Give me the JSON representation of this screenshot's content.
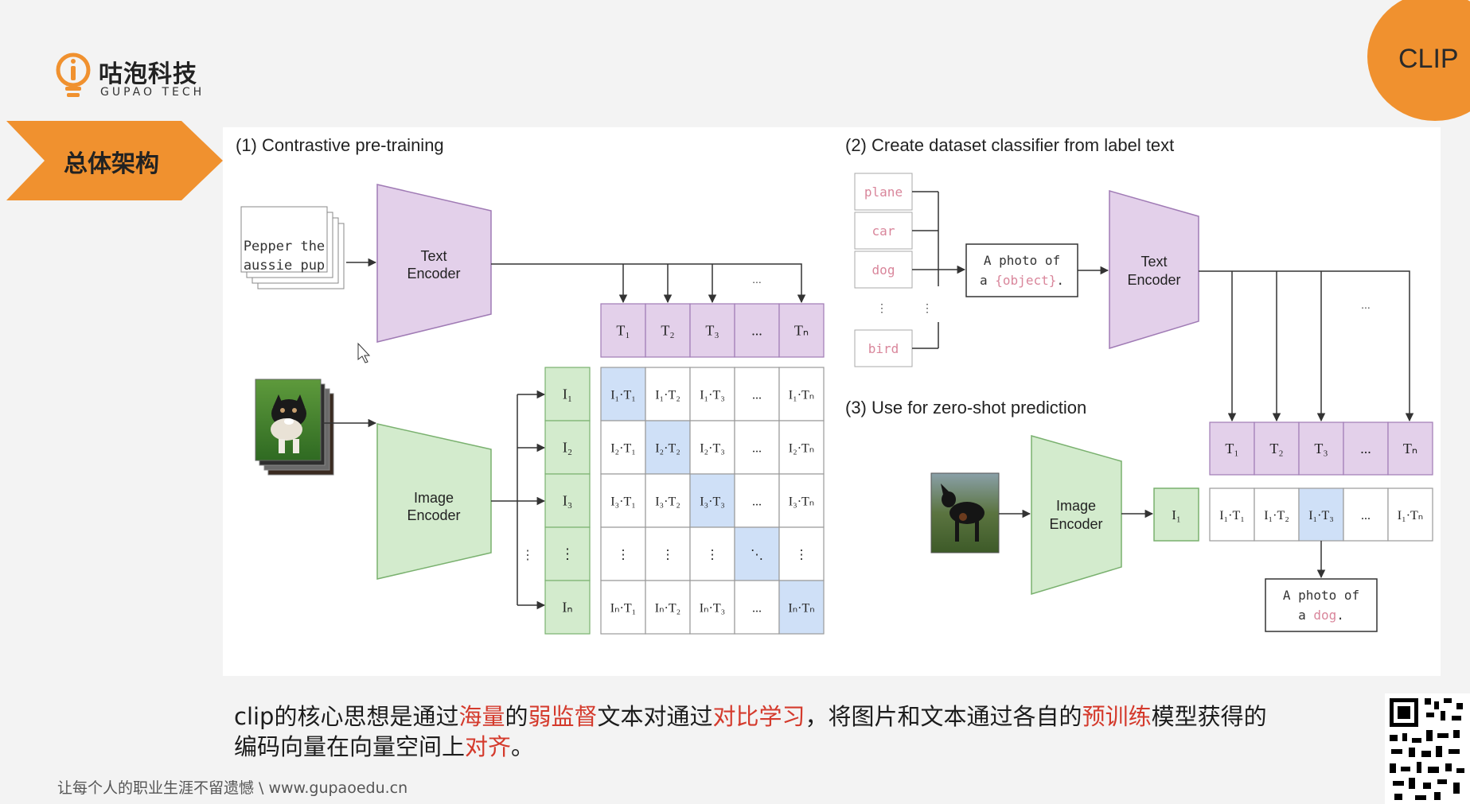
{
  "logo": {
    "cn": "咕泡科技",
    "en": "GUPAO TECH"
  },
  "section": {
    "label": "总体架构"
  },
  "corner": {
    "label": "CLIP"
  },
  "diagram": {
    "panel1": {
      "title": "(1) Contrastive pre-training",
      "text_input_line1": "Pepper the",
      "text_input_line2": "aussie pup",
      "text_encoder_line1": "Text",
      "text_encoder_line2": "Encoder",
      "image_encoder_line1": "Image",
      "image_encoder_line2": "Encoder",
      "t_labels": [
        "T₁",
        "T₂",
        "T₃",
        "...",
        "Tₙ"
      ],
      "i_labels": [
        "I₁",
        "I₂",
        "I₃",
        "⋮",
        "Iₙ"
      ],
      "ellipsis": "...",
      "vdots": "⋮",
      "matrix": [
        [
          "I₁·T₁",
          "I₁·T₂",
          "I₁·T₃",
          "...",
          "I₁·Tₙ"
        ],
        [
          "I₂·T₁",
          "I₂·T₂",
          "I₂·T₃",
          "...",
          "I₂·Tₙ"
        ],
        [
          "I₃·T₁",
          "I₃·T₂",
          "I₃·T₃",
          "...",
          "I₃·Tₙ"
        ],
        [
          "⋮",
          "⋮",
          "⋮",
          "⋱",
          "⋮"
        ],
        [
          "Iₙ·T₁",
          "Iₙ·T₂",
          "Iₙ·T₃",
          "...",
          "Iₙ·Tₙ"
        ]
      ]
    },
    "panel2": {
      "title": "(2) Create dataset classifier from label text",
      "labels": [
        "plane",
        "car",
        "dog",
        "bird"
      ],
      "vdots": "⋮",
      "template_line1": "A photo of",
      "template_prefix": "a ",
      "template_object": "{object}",
      "template_suffix": ".",
      "text_encoder_line1": "Text",
      "text_encoder_line2": "Encoder",
      "ellipsis": "..."
    },
    "panel3": {
      "title": "(3) Use for zero-shot prediction",
      "image_encoder_line1": "Image",
      "image_encoder_line2": "Encoder",
      "i_label": "I₁",
      "t_labels": [
        "T₁",
        "T₂",
        "T₃",
        "...",
        "Tₙ"
      ],
      "products": [
        "I₁·T₁",
        "I₁·T₂",
        "I₁·T₃",
        "...",
        "I₁·Tₙ"
      ],
      "result_line1": "A photo of",
      "result_prefix": "a ",
      "result_object": "dog",
      "result_suffix": "."
    }
  },
  "caption": {
    "l1_a": "clip的核心思想是通过",
    "l1_b": "海量",
    "l1_c": "的",
    "l1_d": "弱监督",
    "l1_e": "文本对通过",
    "l1_f": "对比学习",
    "l1_g": "，将图片和文本通过各自的",
    "l1_h": "预训练",
    "l1_i": "模型获得的",
    "l2_a": "编码向量在向量空间上",
    "l2_b": "对齐",
    "l2_c": "。"
  },
  "footer": {
    "text": "让每个人的职业生涯不留遗憾 \\ www.gupaoedu.cn"
  },
  "colors": {
    "orange": "#f0912f",
    "purple_fill": "#e3d0ea",
    "purple_stroke": "#a07bb5",
    "green_fill": "#d3ebcd",
    "green_stroke": "#7ab16f",
    "blue_fill": "#cfe0f7",
    "red_text": "#d43a2c",
    "label_pink": "#d9869b"
  }
}
